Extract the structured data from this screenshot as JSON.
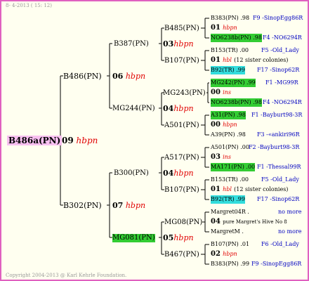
{
  "header": "8- 4-2013 ( 15: 12)",
  "footer": "Copyright 2004-2013 @ Karl Kehrle Foundation.",
  "root": {
    "label": "B486a(PN)",
    "num": "09",
    "brood": "hbpn"
  },
  "g2": [
    {
      "label": "B486(PN)",
      "num": "06",
      "brood": "hbpn"
    },
    {
      "label": "B302(PN)",
      "num": "07",
      "brood": "hbpn"
    }
  ],
  "g3": [
    {
      "label": "B387(PN)",
      "num": "03",
      "brood": "hbpn"
    },
    {
      "label": "MG244(PN)",
      "num": "04",
      "brood": "hbpn"
    },
    {
      "label": "B300(PN)",
      "num": "04",
      "brood": "hbpn"
    },
    {
      "label": "MG081(PN)",
      "num": "05",
      "brood": "hbpn"
    }
  ],
  "g4": [
    {
      "label": "B485(PN)",
      "num": "01",
      "brood": "hbpn"
    },
    {
      "label": "B107(PN)",
      "num": "01",
      "brood": "hbpn"
    },
    {
      "label": "MG243(PN)",
      "num": "00",
      "brood": "ins"
    },
    {
      "label": "A501(PN)",
      "num": "00",
      "brood": "hbpn"
    },
    {
      "label": "A517(PN)",
      "num": "03",
      "brood": "ins"
    },
    {
      "label": "B107(PN)",
      "num": "01",
      "brood": "hbpn"
    },
    {
      "label": "MG08(PN)",
      "num": "04",
      "brood": "pure Margret's Hive No 8"
    },
    {
      "label": "B467(PN)",
      "num": "02",
      "brood": "hbpn"
    }
  ],
  "g5": [
    {
      "a": "B383(PN) .98",
      "b": "F9 -SinopEgg86R"
    },
    {
      "a": "NO6238b(PN) .98",
      "b": "F4 -NO6294R"
    },
    {
      "a": "B153(TR) .00",
      "b": "F5 -Old_Lady"
    },
    {
      "a": "B92(TR) .99",
      "b": "F17 -Sinop62R"
    },
    {
      "a": "MG242(PN) .99",
      "b": "F1 -MG99R"
    },
    {
      "a": "NO6238b(PN) .98",
      "b": "F4 -NO6294R"
    },
    {
      "a": "A31(PN) .98",
      "b": "F1 -Bayburt98-3R"
    },
    {
      "a": "A39(PN) .98",
      "b": "F3 -«ankiri96R"
    },
    {
      "a": "A501(PN) .00",
      "b": "F2 -Bayburt98-3R"
    },
    {
      "a": "MA171(PN) .00",
      "b": "F1 -Thessal99R"
    },
    {
      "a": "B153(TR) .00",
      "b": "F5 -Old_Lady"
    },
    {
      "a": "B92(TR) .99",
      "b": "F17 -Sinop62R"
    },
    {
      "a": "Margret04R .",
      "b": "no more"
    },
    {
      "a": "MargretM .",
      "b": "no more"
    },
    {
      "a": "B107(PN) .01",
      "b": "F6 -Old_Lady"
    },
    {
      "a": "B383(PN) .99",
      "b": "F9 -SinopEgg86R"
    }
  ],
  "g5_mid": [
    {
      "num": "01",
      "brood": "hbpn"
    },
    {
      "num": "01",
      "brood": "hbl",
      "note": "(12 sister colonies)"
    },
    {
      "num": "00",
      "brood": "ins"
    },
    {
      "num": "00",
      "brood": "hbpn"
    },
    {
      "num": "03",
      "brood": "ins"
    },
    {
      "num": "01",
      "brood": "hbl",
      "note": "(12 sister colonies)"
    },
    {
      "num": "04",
      "brood": "pure Margret's Hive No 8"
    },
    {
      "num": "02",
      "brood": "hbpn"
    }
  ],
  "colors": {
    "border": "#e060c0",
    "green": "#33cc33",
    "cyan": "#33dddd",
    "brood": "#e00000",
    "link": "#0000c0"
  }
}
